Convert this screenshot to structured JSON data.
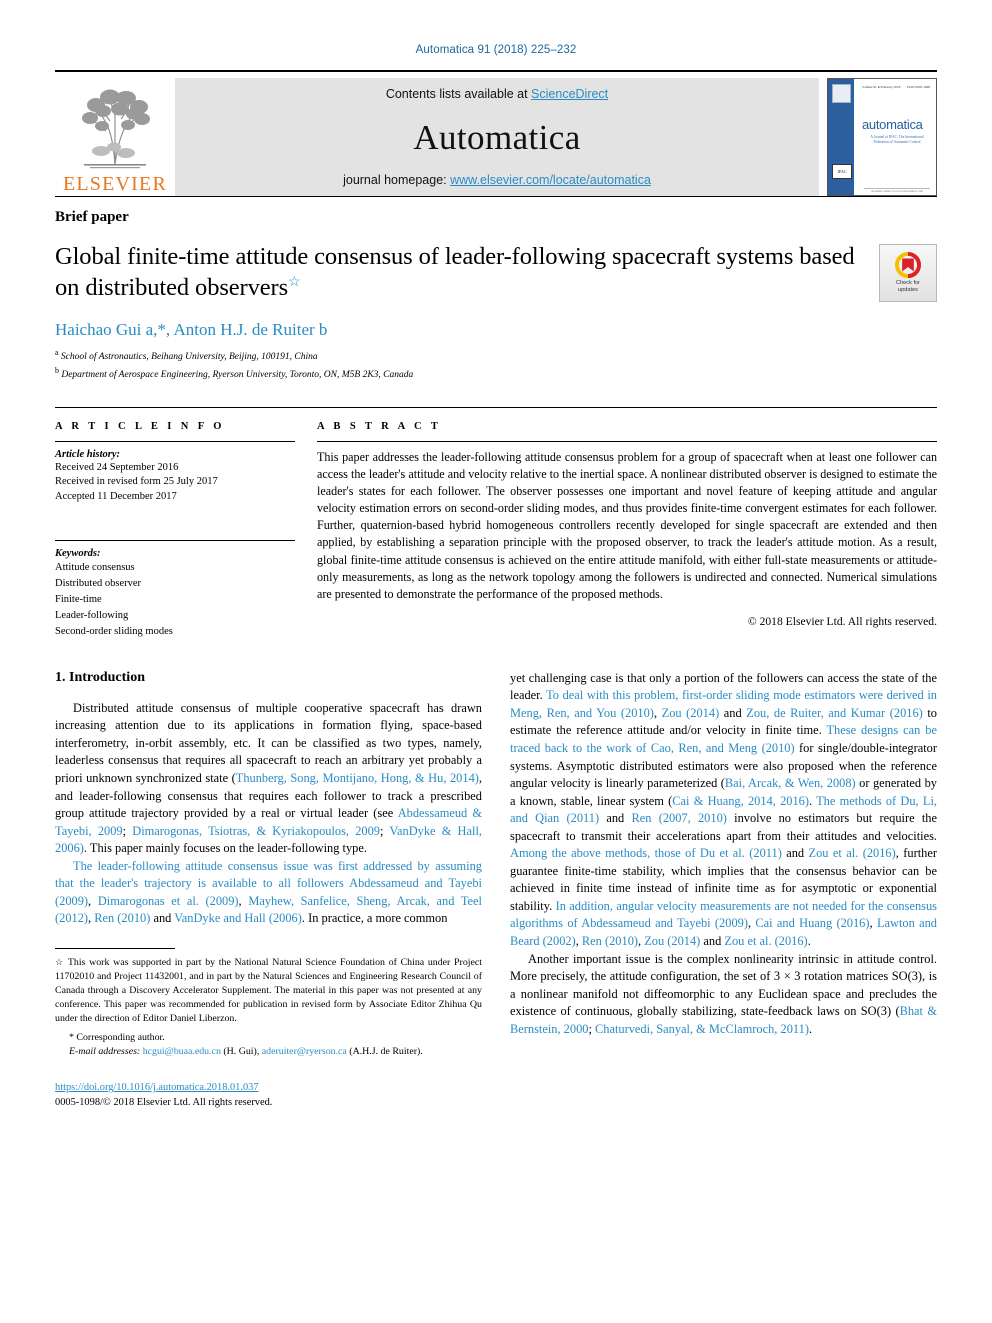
{
  "running_head": "Automatica 91 (2018) 225–232",
  "masthead": {
    "publisher_wordmark": "ELSEVIER",
    "contents_prefix": "Contents lists available at ",
    "contents_link": "ScienceDirect",
    "journal_name": "Automatica",
    "homepage_prefix": "journal homepage: ",
    "homepage_link": "www.elsevier.com/locate/automatica",
    "cover": {
      "title": "automatica",
      "subtitle": "A Journal of IFAC, The International Federation of Automatic Control",
      "volume_line_left": "Volume 91 ● February 2018",
      "volume_line_right": "ISSN 0005-1098",
      "ifac_badge": "IFAC",
      "footer_caption": "Available online at www.sciencedirect.com"
    }
  },
  "article": {
    "type_label": "Brief paper",
    "title": "Global finite-time attitude consensus of leader-following spacecraft systems based on distributed observers",
    "title_footnote_marker": "☆",
    "authors": "Haichao Gui a,*, Anton H.J. de Ruiter b",
    "affiliations": [
      {
        "marker": "a",
        "text": "School of Astronautics, Beihang University, Beijing, 100191, China"
      },
      {
        "marker": "b",
        "text": "Department of Aerospace Engineering, Ryerson University, Toronto, ON, M5B 2K3, Canada"
      }
    ],
    "crossmark": {
      "line1": "Check for",
      "line2": "updates"
    }
  },
  "article_info": {
    "section_label": "A R T I C L E   I N F O",
    "history_heading": "Article history:",
    "history_lines": [
      "Received 24 September 2016",
      "Received in revised form 25 July 2017",
      "Accepted 11 December 2017"
    ],
    "keywords_heading": "Keywords:",
    "keywords": [
      "Attitude consensus",
      "Distributed observer",
      "Finite-time",
      "Leader-following",
      "Second-order sliding modes"
    ]
  },
  "abstract": {
    "section_label": "A B S T R A C T",
    "text": "This paper addresses the leader-following attitude consensus problem for a group of spacecraft when at least one follower can access the leader's attitude and velocity relative to the inertial space. A nonlinear distributed observer is designed to estimate the leader's states for each follower. The observer possesses one important and novel feature of keeping attitude and angular velocity estimation errors on second-order sliding modes, and thus provides finite-time convergent estimates for each follower. Further, quaternion-based hybrid homogeneous controllers recently developed for single spacecraft are extended and then applied, by establishing a separation principle with the proposed observer, to track the leader's attitude motion. As a result, global finite-time attitude consensus is achieved on the entire attitude manifold, with either full-state measurements or attitude-only measurements, as long as the network topology among the followers is undirected and connected. Numerical simulations are presented to demonstrate the performance of the proposed methods.",
    "copyright": "© 2018 Elsevier Ltd. All rights reserved."
  },
  "body": {
    "section_heading": "1. Introduction",
    "left_paragraphs": [
      "Distributed attitude consensus of multiple cooperative spacecraft has drawn increasing attention due to its applications in formation flying, space-based interferometry, in-orbit assembly, etc. It can be classified as two types, namely, leaderless consensus that requires all spacecraft to reach an arbitrary yet probably a priori unknown synchronized state (Thunberg, Song, Montijano, Hong, & Hu, 2014), and leader-following consensus that requires each follower to track a prescribed group attitude trajectory provided by a real or virtual leader (see Abdessameud & Tayebi, 2009; Dimarogonas, Tsiotras, & Kyriakopoulos, 2009; VanDyke & Hall, 2006). This paper mainly focuses on the leader-following type.",
      "The leader-following attitude consensus issue was first addressed by assuming that the leader's trajectory is available to all followers Abdessameud and Tayebi (2009), Dimarogonas et al. (2009), Mayhew, Sanfelice, Sheng, Arcak, and Teel (2012), Ren (2010) and VanDyke and Hall (2006). In practice, a more common"
    ],
    "right_paragraphs": [
      "yet challenging case is that only a portion of the followers can access the state of the leader. To deal with this problem, first-order sliding mode estimators were derived in Meng, Ren, and You (2010), Zou (2014) and Zou, de Ruiter, and Kumar (2016) to estimate the reference attitude and/or velocity in finite time. These designs can be traced back to the work of Cao, Ren, and Meng (2010) for single/double-integrator systems. Asymptotic distributed estimators were also proposed when the reference angular velocity is linearly parameterized (Bai, Arcak, & Wen, 2008) or generated by a known, stable, linear system (Cai & Huang, 2014, 2016). The methods of Du, Li, and Qian (2011) and Ren (2007, 2010) involve no estimators but require the spacecraft to transmit their accelerations apart from their attitudes and velocities. Among the above methods, those of Du et al. (2011) and Zou et al. (2016), further guarantee finite-time stability, which implies that the consensus behavior can be achieved in finite time instead of infinite time as for asymptotic or exponential stability. In addition, angular velocity measurements are not needed for the consensus algorithms of Abdessameud and Tayebi (2009), Cai and Huang (2016), Lawton and Beard (2002), Ren (2010), Zou (2014) and Zou et al. (2016).",
      "Another important issue is the complex nonlinearity intrinsic in attitude control. More precisely, the attitude configuration, the set of 3 × 3 rotation matrices SO(3), is a nonlinear manifold not diffeomorphic to any Euclidean space and precludes the existence of continuous, globally stabilizing, state-feedback laws on SO(3) (Bhat & Bernstein, 2000; Chaturvedi, Sanyal, & McClamroch, 2011)."
    ]
  },
  "footnotes": {
    "funding": "This work was supported in part by the National Natural Science Foundation of China under Project 11702010 and Project 11432001, and in part by the Natural Sciences and Engineering Research Council of Canada through a Discovery Accelerator Supplement. The material in this paper was not presented at any conference. This paper was recommended for publication in revised form by Associate Editor Zhihua Qu under the direction of Editor Daniel Liberzon.",
    "funding_marker": "☆",
    "corresponding": "Corresponding author.",
    "corresponding_marker": "*",
    "email_label": "E-mail addresses:",
    "email_1": "hcgui@buaa.edu.cn",
    "email_1_owner": "(H. Gui)",
    "email_2": "aderuiter@ryerson.ca",
    "email_2_owner": "(A.H.J. de Ruiter).",
    "doi": "https://doi.org/10.1016/j.automatica.2018.01.037",
    "issn_line": "0005-1098/© 2018 Elsevier Ltd. All rights reserved."
  },
  "colors": {
    "link_blue": "#2a8cc4",
    "header_blue": "#1a6aa1",
    "elsevier_orange": "#E87722",
    "band_gray": "#e3e3e3",
    "cover_blue": "#2c5f9e",
    "crossmark_red": "#d8232a",
    "crossmark_yellow": "#f2c200"
  }
}
